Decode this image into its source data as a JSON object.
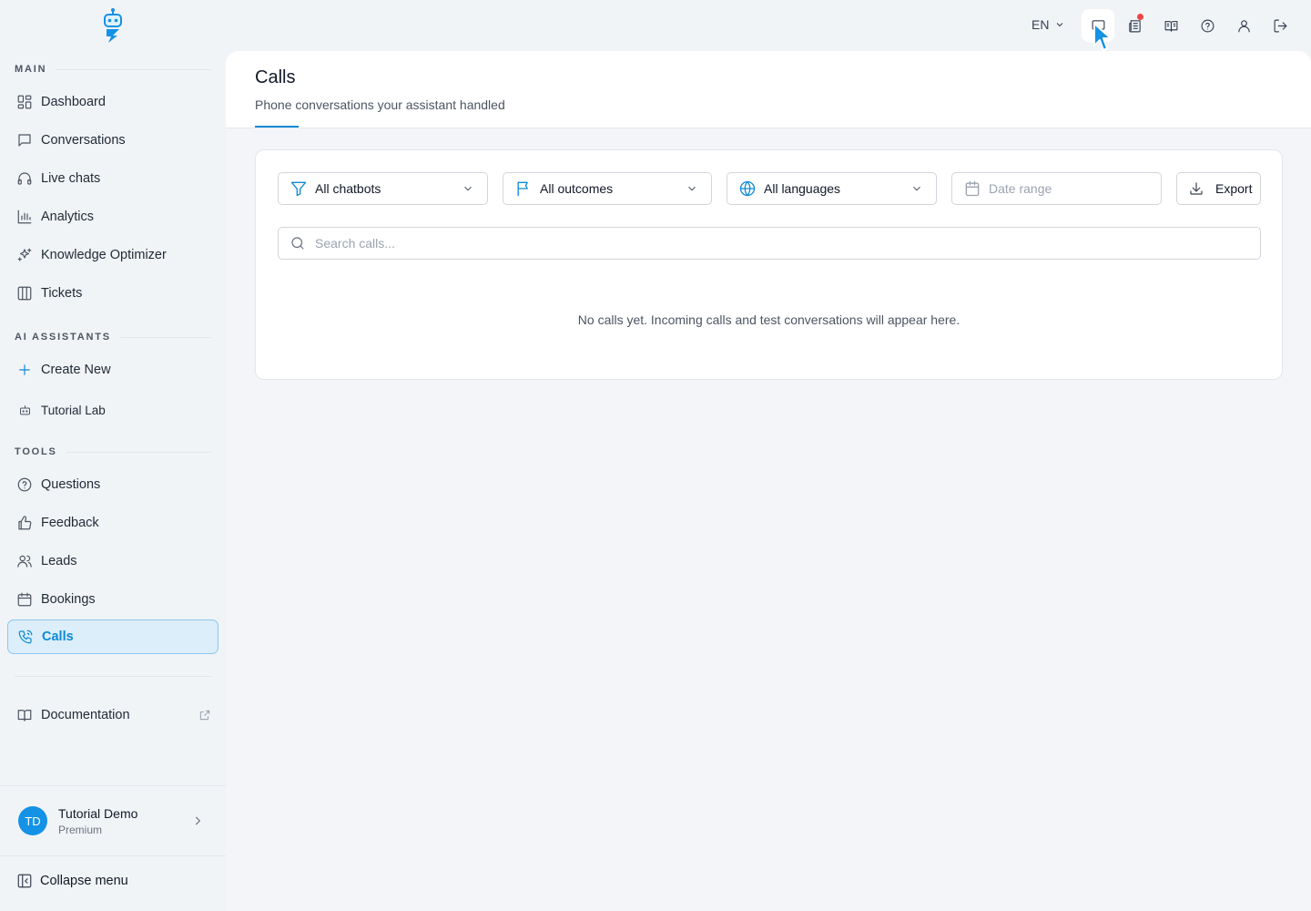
{
  "topbar": {
    "language": "EN",
    "icons": [
      "monitor-icon",
      "newspaper-icon",
      "book-open-icon",
      "help-circle-icon",
      "user-icon",
      "logout-icon"
    ],
    "notification_color": "#ef4444"
  },
  "sidebar": {
    "sections": {
      "main": "MAIN",
      "assistants": "AI ASSISTANTS",
      "tools": "TOOLS"
    },
    "main_items": [
      {
        "label": "Dashboard",
        "icon": "dashboard-icon"
      },
      {
        "label": "Conversations",
        "icon": "message-icon"
      },
      {
        "label": "Live chats",
        "icon": "headphones-icon"
      },
      {
        "label": "Analytics",
        "icon": "bar-chart-icon"
      },
      {
        "label": "Knowledge Optimizer",
        "icon": "sparkles-icon"
      },
      {
        "label": "Tickets",
        "icon": "columns-icon"
      }
    ],
    "assistant_items": [
      {
        "label": "Create New",
        "icon": "plus-icon"
      },
      {
        "label": "Tutorial Lab",
        "icon": "bot-icon"
      }
    ],
    "tool_items": [
      {
        "label": "Questions",
        "icon": "help-circle-icon"
      },
      {
        "label": "Feedback",
        "icon": "thumbs-up-icon"
      },
      {
        "label": "Leads",
        "icon": "users-icon"
      },
      {
        "label": "Bookings",
        "icon": "calendar-icon"
      },
      {
        "label": "Calls",
        "icon": "phone-icon",
        "active": true
      }
    ],
    "documentation": "Documentation",
    "user": {
      "initials": "TD",
      "name": "Tutorial Demo",
      "plan": "Premium"
    },
    "collapse": "Collapse menu"
  },
  "page": {
    "title": "Calls",
    "subtitle": "Phone conversations your assistant handled"
  },
  "filters": {
    "chatbots": "All chatbots",
    "outcomes": "All outcomes",
    "languages": "All languages",
    "date_range": "Date range",
    "export": "Export"
  },
  "search": {
    "placeholder": "Search calls...",
    "value": ""
  },
  "empty_state": "No calls yet. Incoming calls and test conversations will appear here.",
  "colors": {
    "accent": "#0d8ad6",
    "active_bg": "#dbeefa",
    "avatar": "#1492e6"
  }
}
